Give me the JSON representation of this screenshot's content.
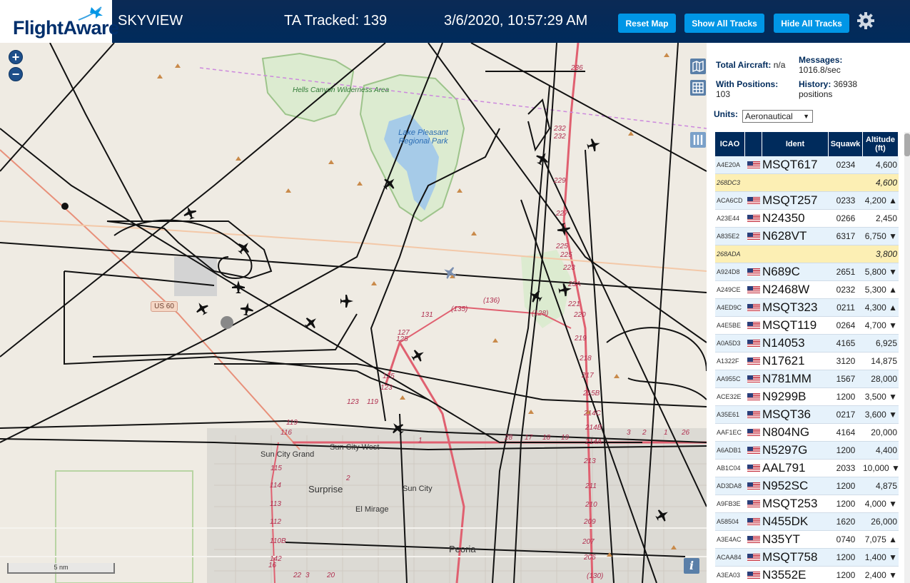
{
  "header": {
    "logo_text": "FlightAware",
    "app_title": "SKYVIEW",
    "ta_tracked": "TA Tracked: 139",
    "clock": "3/6/2020, 10:57:29 AM",
    "reset_map_label": "Reset Map",
    "show_all_tracks_label": "Show All Tracks",
    "hide_all_tracks_label": "Hide All Tracks",
    "settings_icon": "gear-icon",
    "colors": {
      "header_bg": "#002b5c",
      "button": "#0096e6"
    }
  },
  "map": {
    "zoom_in": "+",
    "zoom_out": "−",
    "scale_label": "5 nm",
    "info_label": "i",
    "labels": {
      "hells_canyon": "Hells Canyon Wilderness Area",
      "lake_pleasant": "Lake Pleasant Regional Park",
      "us60": "US 60",
      "sun_city_grand": "Sun City Grand",
      "sun_city_west": "Sun City West",
      "surprise": "Surprise",
      "sun_city": "Sun City",
      "el_mirage": "El Mirage",
      "peoria": "Peoria"
    },
    "route_numbers": [
      "236",
      "232",
      "232",
      "229",
      "227",
      "225",
      "225",
      "223",
      "23A",
      "221",
      "220",
      "219",
      "218",
      "217",
      "215B",
      "214C",
      "214B",
      "214A",
      "213",
      "211",
      "210",
      "209",
      "207",
      "206",
      "(130)",
      "131",
      "(135)",
      "(136)",
      "(128)",
      "127",
      "125",
      "125",
      "123",
      "123",
      "119",
      "119",
      "116",
      "115",
      "114",
      "113",
      "112",
      "110B",
      "142",
      "16",
      "2",
      "1",
      "3",
      "22",
      "20",
      "19",
      "18",
      "17",
      "28",
      "26",
      "1",
      "2",
      "3"
    ],
    "icons": [
      "map-layers-icon",
      "grid-icon",
      "columns-icon",
      "info-icon"
    ]
  },
  "panel": {
    "total_aircraft_label": "Total Aircraft:",
    "total_aircraft_value": "n/a",
    "messages_label": "Messages:",
    "messages_value": "1016.8/sec",
    "with_positions_label": "With Positions:",
    "with_positions_value": "103",
    "history_label": "History:",
    "history_value": "36938 positions",
    "units_label": "Units:",
    "units_value": "Aeronautical",
    "columns": {
      "icao": "ICAO",
      "ident": "Ident",
      "squawk": "Squawk",
      "altitude": "Altitude (ft)"
    },
    "rows": [
      {
        "icao": "A4E20A",
        "flag": true,
        "ident": "MSQT617",
        "squawk": "0234",
        "alt": "4,600",
        "noposition": false
      },
      {
        "icao": "268DC3",
        "flag": false,
        "ident": "",
        "squawk": "",
        "alt": "4,600",
        "noposition": true
      },
      {
        "icao": "ACA6CD",
        "flag": true,
        "ident": "MSQT257",
        "squawk": "0233",
        "alt": "4,200 ▲",
        "noposition": false
      },
      {
        "icao": "A23E44",
        "flag": true,
        "ident": "N24350",
        "squawk": "0266",
        "alt": "2,450",
        "noposition": false
      },
      {
        "icao": "A835E2",
        "flag": true,
        "ident": "N628VT",
        "squawk": "6317",
        "alt": "6,750 ▼",
        "noposition": false
      },
      {
        "icao": "268ADA",
        "flag": false,
        "ident": "",
        "squawk": "",
        "alt": "3,800",
        "noposition": true
      },
      {
        "icao": "A924D8",
        "flag": true,
        "ident": "N689C",
        "squawk": "2651",
        "alt": "5,800 ▼",
        "noposition": false
      },
      {
        "icao": "A249CE",
        "flag": true,
        "ident": "N2468W",
        "squawk": "0232",
        "alt": "5,300 ▲",
        "noposition": false
      },
      {
        "icao": "A4ED9C",
        "flag": true,
        "ident": "MSQT323",
        "squawk": "0211",
        "alt": "4,300 ▲",
        "noposition": false
      },
      {
        "icao": "A4E5BE",
        "flag": true,
        "ident": "MSQT119",
        "squawk": "0264",
        "alt": "4,700 ▼",
        "noposition": false
      },
      {
        "icao": "A0A5D3",
        "flag": true,
        "ident": "N14053",
        "squawk": "4165",
        "alt": "6,925",
        "noposition": false
      },
      {
        "icao": "A1322F",
        "flag": true,
        "ident": "N17621",
        "squawk": "3120",
        "alt": "14,875",
        "noposition": false
      },
      {
        "icao": "AA955C",
        "flag": true,
        "ident": "N781MM",
        "squawk": "1567",
        "alt": "28,000",
        "noposition": false
      },
      {
        "icao": "ACE32E",
        "flag": true,
        "ident": "N9299B",
        "squawk": "1200",
        "alt": "3,500 ▼",
        "noposition": false
      },
      {
        "icao": "A35E61",
        "flag": true,
        "ident": "MSQT36",
        "squawk": "0217",
        "alt": "3,600 ▼",
        "noposition": false
      },
      {
        "icao": "AAF1EC",
        "flag": true,
        "ident": "N804NG",
        "squawk": "4164",
        "alt": "20,000",
        "noposition": false
      },
      {
        "icao": "A6ADB1",
        "flag": true,
        "ident": "N5297G",
        "squawk": "1200",
        "alt": "4,400",
        "noposition": false
      },
      {
        "icao": "AB1C04",
        "flag": true,
        "ident": "AAL791",
        "squawk": "2033",
        "alt": "10,000 ▼",
        "noposition": false
      },
      {
        "icao": "AD3DA8",
        "flag": true,
        "ident": "N952SC",
        "squawk": "1200",
        "alt": "4,875",
        "noposition": false
      },
      {
        "icao": "A9FB3E",
        "flag": true,
        "ident": "MSQT253",
        "squawk": "1200",
        "alt": "4,000 ▼",
        "noposition": false
      },
      {
        "icao": "A58504",
        "flag": true,
        "ident": "N455DK",
        "squawk": "1620",
        "alt": "26,000",
        "noposition": false
      },
      {
        "icao": "A3E4AC",
        "flag": true,
        "ident": "N35YT",
        "squawk": "0740",
        "alt": "7,075 ▲",
        "noposition": false
      },
      {
        "icao": "ACAA84",
        "flag": true,
        "ident": "MSQT758",
        "squawk": "1200",
        "alt": "1,400 ▼",
        "noposition": false
      },
      {
        "icao": "A3EA03",
        "flag": true,
        "ident": "N3552E",
        "squawk": "1200",
        "alt": "2,400 ▼",
        "noposition": false
      }
    ]
  }
}
